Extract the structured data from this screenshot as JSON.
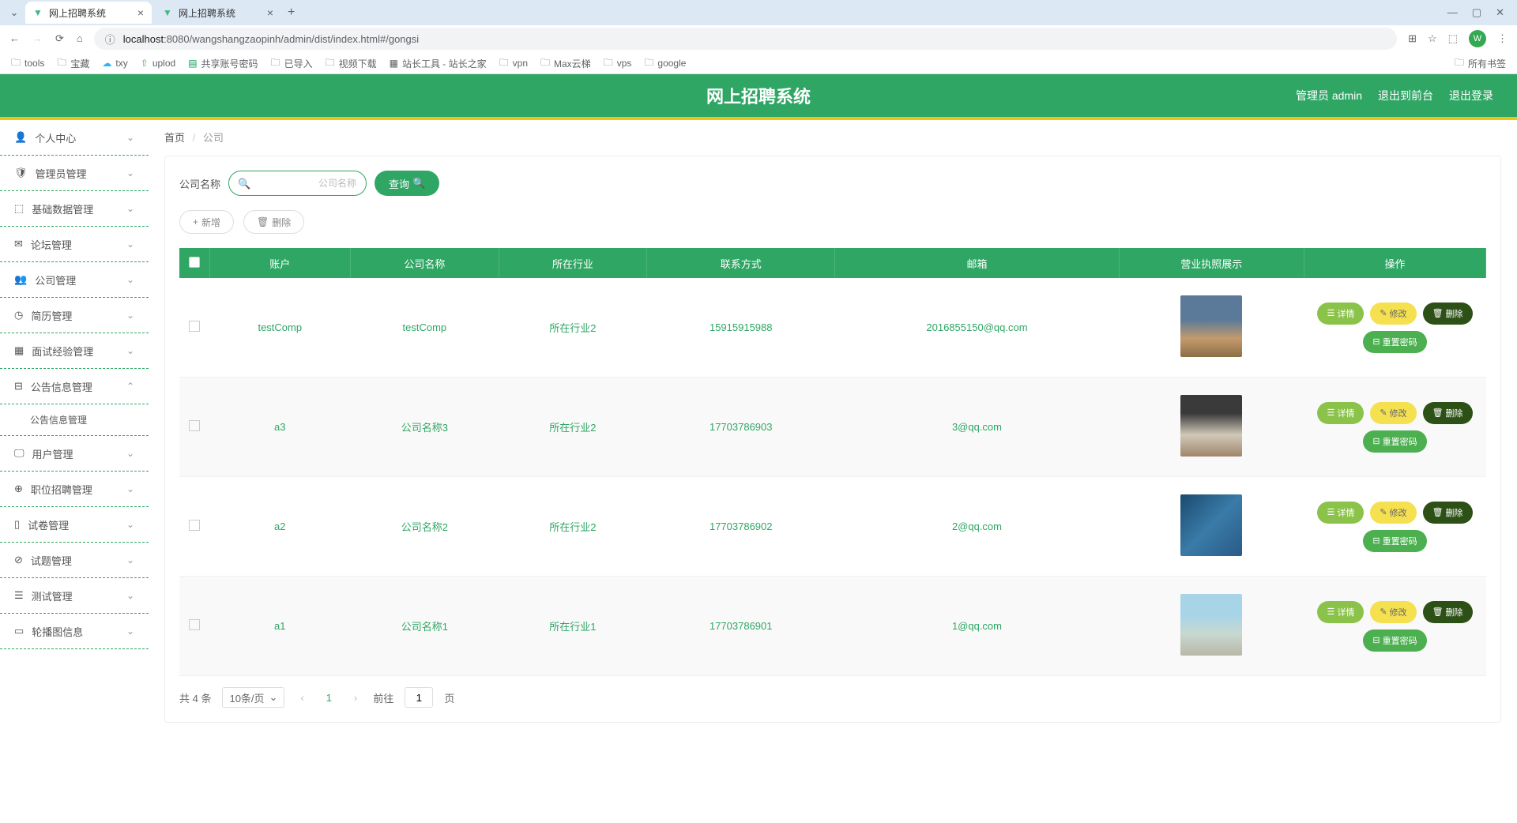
{
  "browser": {
    "tabs": [
      {
        "title": "网上招聘系统",
        "active": true
      },
      {
        "title": "网上招聘系统",
        "active": false
      }
    ],
    "url_host": "localhost",
    "url_rest": ":8080/wangshangzaopinh/admin/dist/index.html#/gongsi",
    "bookmarks": [
      "tools",
      "宝藏",
      "txy",
      "uplod",
      "共享账号密码",
      "已导入",
      "视频下载",
      "站长工具 - 站长之家",
      "vpn",
      "Max云梯",
      "vps",
      "google"
    ],
    "all_bookmarks": "所有书签",
    "avatar": "W"
  },
  "app": {
    "title": "网上招聘系统",
    "admin_label": "管理员 admin",
    "front_label": "退出到前台",
    "logout_label": "退出登录"
  },
  "sidebar": {
    "items": [
      {
        "label": "个人中心"
      },
      {
        "label": "管理员管理"
      },
      {
        "label": "基础数据管理"
      },
      {
        "label": "论坛管理"
      },
      {
        "label": "公司管理"
      },
      {
        "label": "简历管理"
      },
      {
        "label": "面试经验管理"
      },
      {
        "label": "公告信息管理",
        "expanded": true,
        "sub": [
          {
            "label": "公告信息管理"
          }
        ]
      },
      {
        "label": "用户管理"
      },
      {
        "label": "职位招聘管理"
      },
      {
        "label": "试卷管理"
      },
      {
        "label": "试题管理"
      },
      {
        "label": "测试管理"
      },
      {
        "label": "轮播图信息"
      }
    ]
  },
  "breadcrumb": {
    "home": "首页",
    "current": "公司"
  },
  "search": {
    "label": "公司名称",
    "placeholder": "公司名称",
    "btn": "查询"
  },
  "tools": {
    "add": "新增",
    "del": "删除"
  },
  "columns": [
    "账户",
    "公司名称",
    "所在行业",
    "联系方式",
    "邮箱",
    "营业执照展示",
    "操作"
  ],
  "rows": [
    {
      "account": "testComp",
      "name": "testComp",
      "industry": "所在行业2",
      "contact": "15915915988",
      "email": "2016855150@qq.com"
    },
    {
      "account": "a3",
      "name": "公司名称3",
      "industry": "所在行业2",
      "contact": "17703786903",
      "email": "3@qq.com"
    },
    {
      "account": "a2",
      "name": "公司名称2",
      "industry": "所在行业2",
      "contact": "17703786902",
      "email": "2@qq.com"
    },
    {
      "account": "a1",
      "name": "公司名称1",
      "industry": "所在行业1",
      "contact": "17703786901",
      "email": "1@qq.com"
    }
  ],
  "ops": {
    "detail": "详情",
    "edit": "修改",
    "del": "删除",
    "reset": "重置密码"
  },
  "pagination": {
    "total": "共 4 条",
    "page_size": "10条/页",
    "current": "1",
    "goto_label": "前往",
    "goto_val": "1",
    "page_suffix": "页"
  }
}
